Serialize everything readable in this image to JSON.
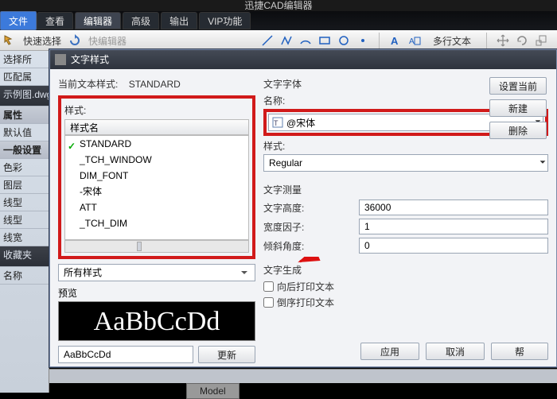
{
  "app": {
    "title": "迅捷CAD编辑器"
  },
  "menu": {
    "file": "文件",
    "view": "查看",
    "editor": "编辑器",
    "advanced": "高级",
    "output": "输出",
    "vip": "VIP功能"
  },
  "ribbon": {
    "quick_select": "快速选择",
    "quick_editor": "快编辑器",
    "multiline_text": "多行文本"
  },
  "leftpanel": {
    "select_all": "选择所",
    "match_prop": "匹配属",
    "file_label": "示例图.dwg",
    "properties": "属性",
    "defaults": "默认值",
    "general": "一般设置",
    "color": "色彩",
    "layer": "图层",
    "linetype": "线型",
    "linetype2": "线型",
    "lineweight": "线宽",
    "favorites": "收藏夹",
    "name": "名称"
  },
  "dialog": {
    "title": "文字样式",
    "current_label": "当前文本样式:",
    "current_value": "STANDARD",
    "style_group": "样式:",
    "style_header": "样式名",
    "styles": [
      "STANDARD",
      "_TCH_WINDOW",
      "DIM_FONT",
      "-宋体",
      "ATT",
      "_TCH_DIM"
    ],
    "all_styles": "所有样式",
    "preview_label": "预览",
    "preview_text": "AaBbCcDd",
    "preview_input": "AaBbCcDd",
    "update_btn": "更新",
    "font_group": "文字字体",
    "name_label": "名称:",
    "font_name": "@宋体",
    "style_label": "样式:",
    "style_value": "Regular",
    "measure_group": "文字测量",
    "height_label": "文字高度:",
    "height_value": "36000",
    "width_label": "宽度因子:",
    "width_value": "1",
    "oblique_label": "倾斜角度:",
    "oblique_value": "0",
    "gen_group": "文字生成",
    "backward": "向后打印文本",
    "upsidedown": "倒序打印文本",
    "set_current": "设置当前",
    "new_btn": "新建",
    "delete_btn": "删除",
    "apply": "应用",
    "cancel": "取消",
    "help": "帮"
  },
  "status": {
    "model_tab": "Model"
  }
}
